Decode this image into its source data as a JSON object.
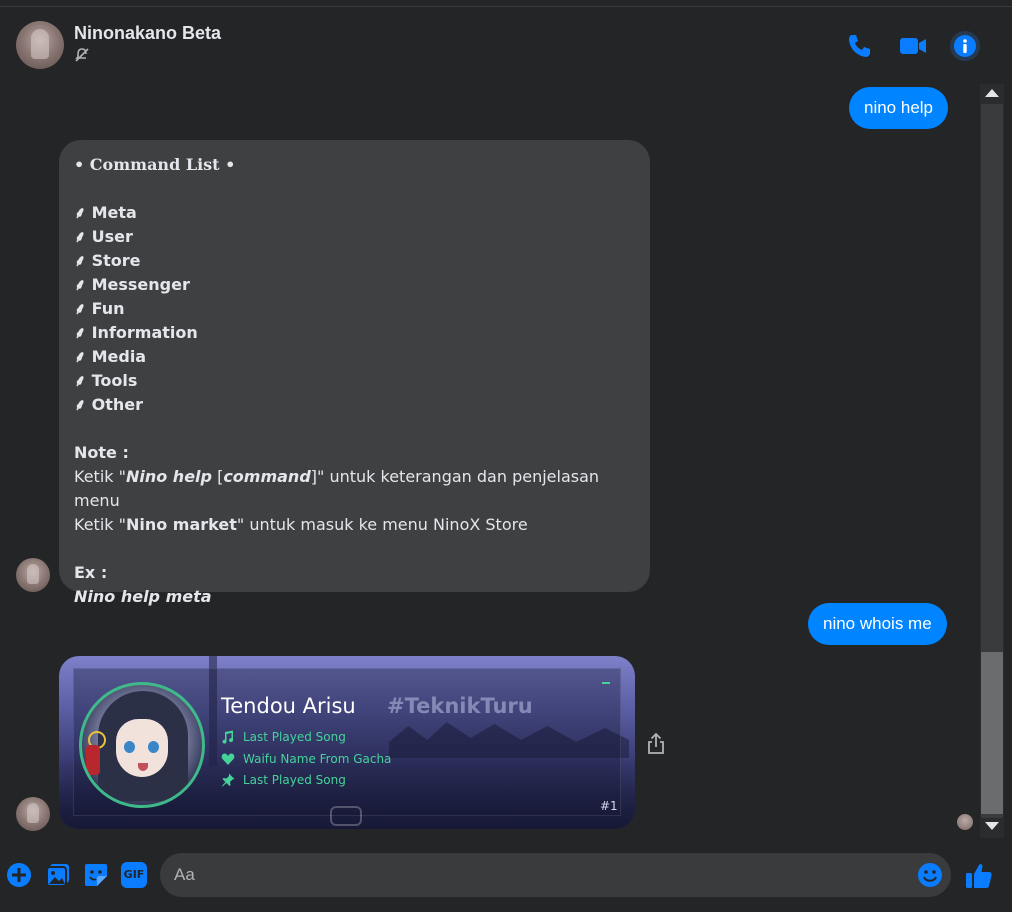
{
  "header": {
    "title": "Ninonakano Beta",
    "muted_icon": "bell-slash-icon",
    "call_icon": "phone-icon",
    "video_icon": "video-camera-icon",
    "info_icon": "info-icon",
    "accent": "#0a7cff"
  },
  "messages": [
    {
      "type": "outgoing",
      "text": "nino help"
    },
    {
      "type": "incoming",
      "title": "• Command List •",
      "bullet": "⸙",
      "items": [
        "Meta",
        "User",
        "Store",
        "Messenger",
        "Fun",
        "Information",
        "Media",
        "Tools",
        "Other"
      ],
      "note_label": "Note :",
      "note_line1": {
        "prefix": "Ketik \"",
        "bold_italic": "Nino help",
        "mid": " [",
        "cmd": "command",
        "suffix": "]\" untuk keterangan dan penjelasan menu"
      },
      "note_line2": {
        "prefix": "Ketik \"",
        "bold": "Nino market",
        "suffix": "\" untuk masuk ke menu NinoX Store"
      },
      "ex_label": "Ex :",
      "ex_value": "Nino help meta"
    },
    {
      "type": "outgoing",
      "text": "nino whois me"
    },
    {
      "type": "incoming-card",
      "name": "Tendou Arisu",
      "tag": "#TeknikTuru",
      "lines": [
        {
          "icon": "music-note-icon",
          "text": "Last Played Song"
        },
        {
          "icon": "heart-icon",
          "text": "Waifu Name From Gacha"
        },
        {
          "icon": "pin-icon",
          "text": "Last Played Song"
        }
      ],
      "rank": "#1",
      "accent": "#45d39a"
    }
  ],
  "composer": {
    "placeholder": "Aa",
    "icons": [
      "plus-circle-icon",
      "image-icon",
      "sticker-icon",
      "gif-icon"
    ],
    "gif_label": "GIF",
    "emoji_icon": "smiley-icon",
    "like_icon": "thumbs-up-icon"
  }
}
